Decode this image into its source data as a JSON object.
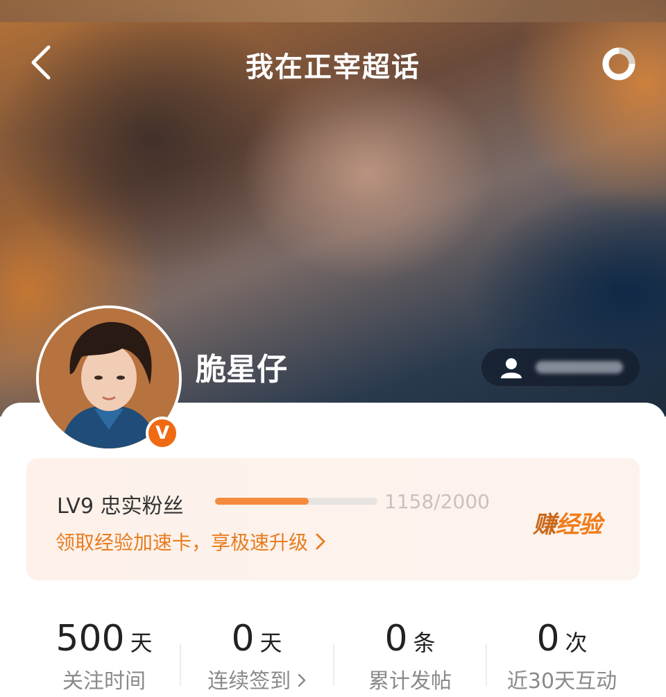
{
  "header": {
    "title": "我在正宰超话",
    "back_icon": "chevron-left-icon",
    "refresh_icon": "refresh-ring-icon"
  },
  "profile": {
    "name": "脆星仔",
    "verified_badge": "V",
    "follow_icon": "user-icon"
  },
  "level": {
    "label": "LV9 忠实粉丝",
    "progress_text": "1158/2000",
    "progress_value": 1158,
    "progress_max": 2000,
    "boost_link": "领取经验加速卡，享极速升级",
    "earn_part1": "赚",
    "earn_part2": "经验"
  },
  "stats": [
    {
      "value": "500",
      "unit": "天",
      "label": "关注时间"
    },
    {
      "value": "0",
      "unit": "天",
      "label": "连续签到"
    },
    {
      "value": "0",
      "unit": "条",
      "label": "累计发帖"
    },
    {
      "value": "0",
      "unit": "次",
      "label": "近30天互动"
    }
  ],
  "colors": {
    "accent": "#f58a3f",
    "link": "#e87d20",
    "badge": "#f06a13"
  }
}
